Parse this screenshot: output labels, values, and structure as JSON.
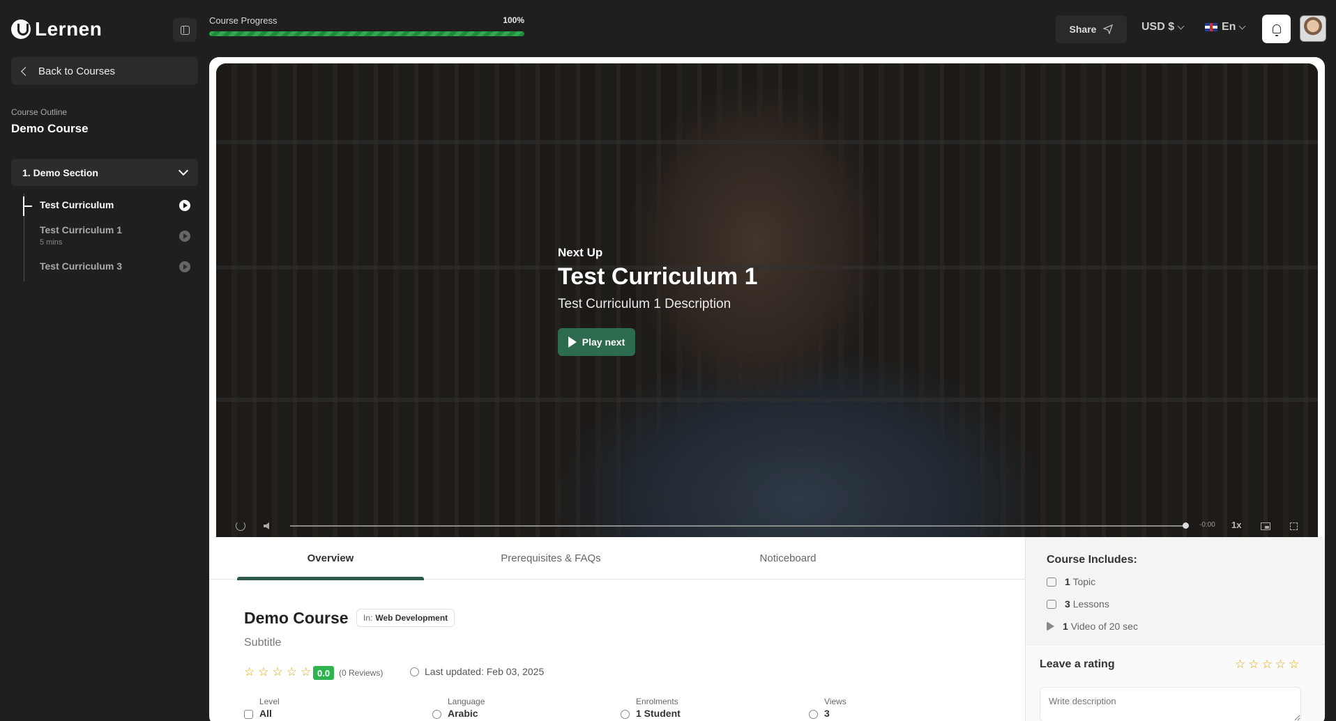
{
  "brand": {
    "name": "Lernen"
  },
  "progress": {
    "label": "Course Progress",
    "percent_label": "100%",
    "value": 1.0
  },
  "header": {
    "share_label": "Share",
    "currency_label": "USD $",
    "language_label": "En"
  },
  "sidebar": {
    "back_label": "Back to Courses",
    "outline_label": "Course Outline",
    "course_title": "Demo Course",
    "section_label": "1. Demo Section",
    "items": [
      {
        "label": "Test Curriculum",
        "meta": ""
      },
      {
        "label": "Test Curriculum 1",
        "meta": "5 mins"
      },
      {
        "label": "Test Curriculum 3",
        "meta": ""
      }
    ]
  },
  "player": {
    "next_up_label": "Next Up",
    "next_title": "Test Curriculum 1",
    "next_description": "Test Curriculum 1 Description",
    "play_next_label": "Play next",
    "time_remaining": "-0:00",
    "speed": "1x"
  },
  "tabs": [
    {
      "label": "Overview"
    },
    {
      "label": "Prerequisites & FAQs"
    },
    {
      "label": "Noticeboard"
    }
  ],
  "course": {
    "title": "Demo Course",
    "category_prefix": "In:",
    "category": "Web Development",
    "subtitle": "Subtitle",
    "rating": "0.0",
    "reviews": "(0 Reviews)",
    "last_updated": "Last updated: Feb 03, 2025",
    "stats": [
      {
        "label": "Level",
        "value": "All",
        "icon": "level-icon"
      },
      {
        "label": "Language",
        "value": "Arabic",
        "icon": "globe-icon"
      },
      {
        "label": "Enrolments",
        "value": "1 Student",
        "icon": "users-icon"
      },
      {
        "label": "Views",
        "value": "3",
        "icon": "eye-icon"
      }
    ]
  },
  "includes": {
    "title": "Course Includes:",
    "items": [
      {
        "count": "1",
        "label": "Topic",
        "icon": "topic-icon"
      },
      {
        "count": "3",
        "label": "Lessons",
        "icon": "book-icon"
      },
      {
        "count": "1",
        "label": "Video of 20 sec",
        "icon": "play-icon"
      }
    ]
  },
  "rating_form": {
    "title": "Leave a rating",
    "placeholder": "Write description"
  },
  "colors": {
    "accent": "#2c6b4e",
    "progress": "#2fa84f",
    "star": "#e2a400",
    "rating_badge": "#2fb34f"
  }
}
